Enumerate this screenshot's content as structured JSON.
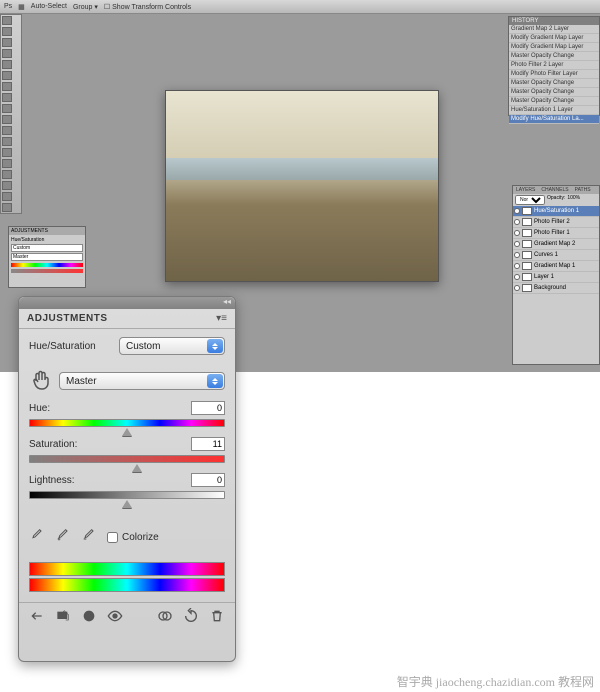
{
  "menubar": {
    "items": [
      "Ps",
      "▦",
      "Auto-Select",
      "Group ▾",
      "☐ Show Transform Controls"
    ]
  },
  "history": {
    "title": "HISTORY",
    "items": [
      "Gradient Map 2 Layer",
      "Modify Gradient Map Layer",
      "Modify Gradient Map Layer",
      "Master Opacity Change",
      "Photo Filter 2 Layer",
      "Modify Photo Filter Layer",
      "Master Opacity Change",
      "Master Opacity Change",
      "Master Opacity Change",
      "Hue/Saturation 1 Layer",
      "Modify Hue/Saturation La..."
    ],
    "selected": 10
  },
  "layers": {
    "tabs": [
      "LAYERS",
      "CHANNELS",
      "PATHS"
    ],
    "mode": "Normal",
    "opacity_label": "Opacity:",
    "opacity": "100%",
    "items": [
      {
        "name": "Hue/Saturation 1",
        "sel": true
      },
      {
        "name": "Photo Filter 2",
        "sel": false
      },
      {
        "name": "Photo Filter 1",
        "sel": false
      },
      {
        "name": "Gradient Map 2",
        "sel": false
      },
      {
        "name": "Curves 1",
        "sel": false
      },
      {
        "name": "Gradient Map 1",
        "sel": false
      },
      {
        "name": "Layer 1",
        "sel": false
      },
      {
        "name": "Background",
        "sel": false
      }
    ]
  },
  "mini_adj": {
    "title": "ADJUSTMENTS",
    "preset": "Custom",
    "row1": "Hue/Saturation",
    "row2": "Master"
  },
  "adjustments": {
    "panel_title": "ADJUSTMENTS",
    "type_label": "Hue/Saturation",
    "preset": "Custom",
    "range": "Master",
    "hue": {
      "label": "Hue:",
      "value": "0",
      "pos": 50
    },
    "saturation": {
      "label": "Saturation:",
      "value": "11",
      "pos": 55
    },
    "lightness": {
      "label": "Lightness:",
      "value": "0",
      "pos": 50
    },
    "colorize_label": "Colorize",
    "colorize_checked": false
  },
  "footer": {
    "icons_left": [
      "back-arrow",
      "expand",
      "mask",
      "visibility"
    ],
    "icons_right": [
      "clip",
      "reset",
      "trash"
    ]
  },
  "watermark": "智宇典 jiaocheng.chazidian.com 教程网"
}
